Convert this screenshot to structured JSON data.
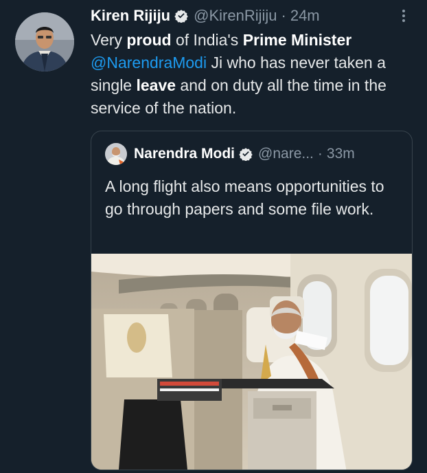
{
  "tweet": {
    "author_name": "Kiren Rijiju",
    "handle": "@KirenRijiju",
    "separator": "·",
    "time": "24m",
    "text": {
      "p1": "Very ",
      "b1": "proud",
      "p2": " of India's ",
      "b2": "Prime Minister",
      "mention": "@NarendraModi",
      "p3": " Ji who has never taken a single ",
      "b3": "leave",
      "p4": " and on duty all the time in the service of the nation."
    }
  },
  "quoted": {
    "author_name": "Narendra Modi",
    "handle": "@nare...",
    "separator": "·",
    "time": "33m",
    "text": "A long flight also means opportunities to go through papers and some file work."
  },
  "colors": {
    "background": "#15202b",
    "link": "#1d9bf0",
    "muted": "#8b98a5",
    "verified": "#1d9bf0",
    "border": "#38444d"
  },
  "icons": {
    "verified": "verified-badge-icon",
    "more": "more-options-icon"
  }
}
